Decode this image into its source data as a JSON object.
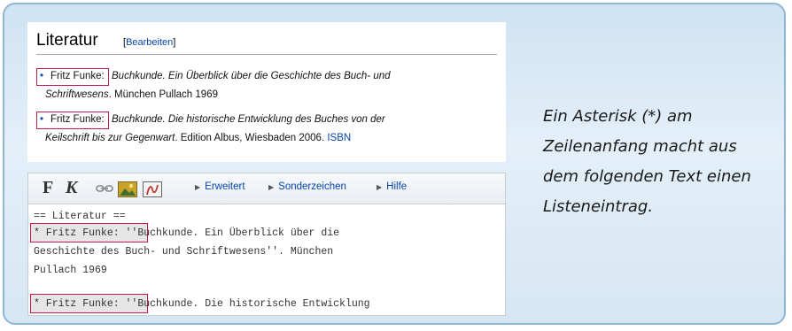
{
  "rendered": {
    "heading": "Literatur",
    "edit_open": "[",
    "edit_link": "Bearbeiten",
    "edit_close": "]",
    "items": [
      {
        "bullet": "•",
        "author": "Fritz Funke:",
        "line1_italic": "Buchkunde. Ein Überblick über die Geschichte des Buch- und",
        "line2_italic": "Schriftwesens",
        "line2_rest": ". München Pullach 1969",
        "line2_link": ""
      },
      {
        "bullet": "•",
        "author": "Fritz Funke:",
        "line1_italic": "Buchkunde. Die historische Entwicklung des Buches von der",
        "line2_italic": "Keilschrift bis zur Gegenwart",
        "line2_rest": ". Edition Albus, Wiesbaden 2006.",
        "line2_link": "ISBN"
      }
    ]
  },
  "editor": {
    "toolbar": {
      "bold_label": "F",
      "italic_label": "K",
      "menus": [
        "Erweitert",
        "Sonderzeichen",
        "Hilfe"
      ]
    },
    "lines": [
      "== Literatur ==",
      "* Fritz Funke: ''Buchkunde. Ein Überblick über die",
      "Geschichte des Buch- und Schriftwesens''. München",
      "Pullach 1969",
      "* Fritz Funke: ''Buchkunde. Die historische Entwicklung"
    ]
  },
  "caption": "Ein Asterisk (*) am Zeilenanfang macht aus dem folgenden Text einen Listeneintrag.",
  "colors": {
    "highlight": "#c2185b",
    "link": "#0645ad",
    "card_background": "#d6e6f3"
  },
  "icons": [
    "link-icon",
    "image-icon",
    "media-icon"
  ]
}
